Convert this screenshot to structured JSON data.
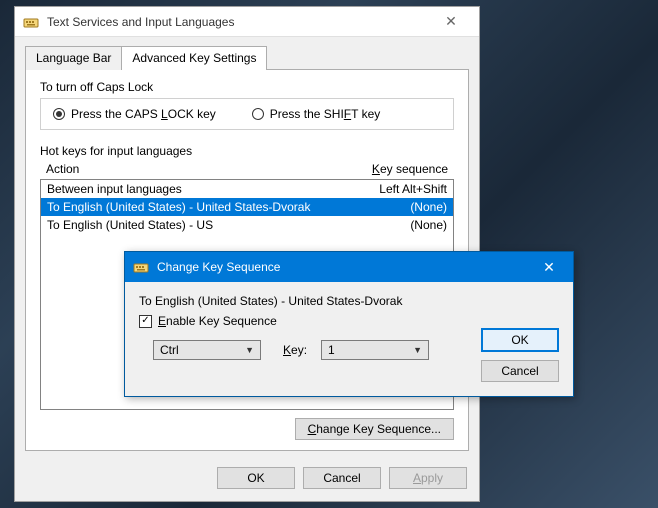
{
  "main": {
    "title": "Text Services and Input Languages",
    "tabs": [
      {
        "label": "Language Bar"
      },
      {
        "label": "Advanced Key Settings"
      }
    ],
    "capslock": {
      "group_label": "To turn off Caps Lock",
      "option_caps_pre": "Press the CAPS ",
      "option_caps_u": "L",
      "option_caps_post": "OCK key",
      "option_shift_pre": "Press the SHI",
      "option_shift_u": "F",
      "option_shift_post": "T key"
    },
    "hotkeys": {
      "group_label": "Hot keys for input languages",
      "header_action": "Action",
      "header_key_u": "K",
      "header_key_post": "ey sequence",
      "rows": [
        {
          "action": "Between input languages",
          "keyseq": "Left Alt+Shift"
        },
        {
          "action": "To English (United States) - United States-Dvorak",
          "keyseq": "(None)"
        },
        {
          "action": "To English (United States) - US",
          "keyseq": "(None)"
        }
      ],
      "change_button_u": "C",
      "change_button_post": "hange Key Sequence..."
    },
    "footer": {
      "ok": "OK",
      "cancel": "Cancel",
      "apply_u": "A",
      "apply_post": "pply"
    }
  },
  "modal": {
    "title": "Change Key Sequence",
    "target": "To English (United States) - United States-Dvorak",
    "enable_u": "E",
    "enable_post": "nable Key Sequence",
    "modifier_value": "Ctrl",
    "key_label_u": "K",
    "key_label_post": "ey:",
    "key_value": "1",
    "ok": "OK",
    "cancel": "Cancel"
  }
}
